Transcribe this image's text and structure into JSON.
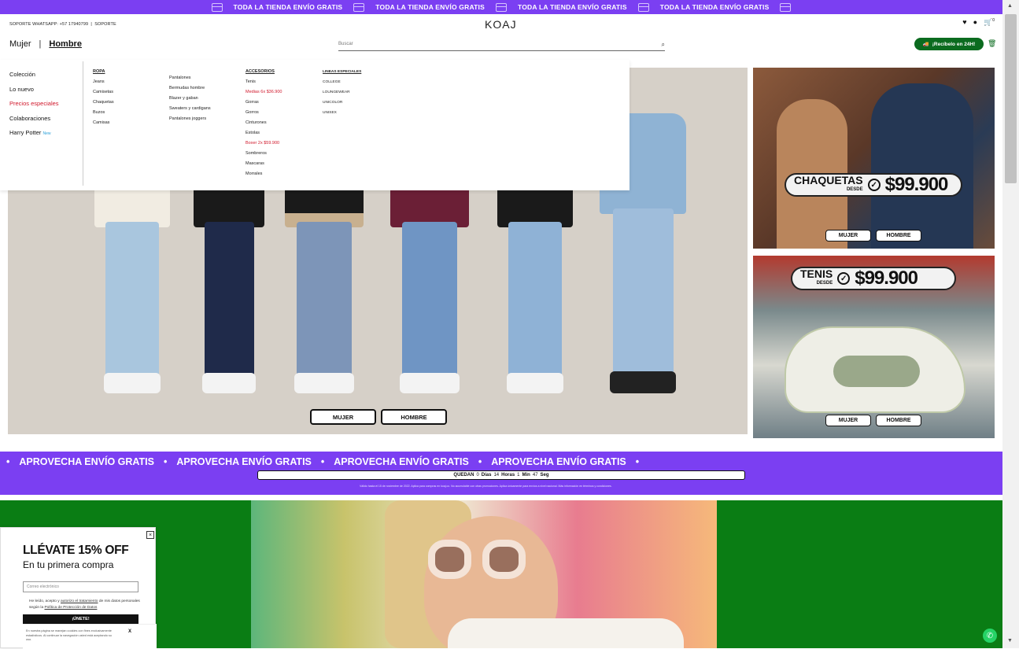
{
  "announcement": {
    "text": "TODA LA TIENDA ENVÍO GRATIS"
  },
  "header": {
    "support_text": "SOPORTE WHATSAPP: +57 17940799",
    "support_link": "SOPORTE",
    "logo": "KOAJ",
    "nav_mujer": "Mujer",
    "nav_sep": "|",
    "nav_hombre": "Hombre",
    "search_placeholder": "Buscar",
    "recibelo": "¡Recíbelo en 24H!",
    "cart_count": "0"
  },
  "dropdown": {
    "left": [
      {
        "label": "Colección"
      },
      {
        "label": "Lo nuevo"
      },
      {
        "label": "Precios especiales"
      },
      {
        "label": "Colaboraciones"
      },
      {
        "label": "Harry Potter",
        "badge": "New"
      }
    ],
    "ropa": {
      "head": "ROPA",
      "col1": [
        "Jeans",
        "Camisetas",
        "Chaquetas",
        "Buzos",
        "Camisas"
      ],
      "col2": [
        "Pantalones",
        "Bermudas hombre",
        "Blazer y gaban",
        "Sweaters y cardigans",
        "Pantalones joggers"
      ]
    },
    "accesorios": {
      "head": "ACCESORIOS",
      "items": [
        "Tenis",
        "Medias 6x $36.900",
        "Gorras",
        "Gorros",
        "Cinturones",
        "Estolas",
        "Boxer 2x $59.900",
        "Sombreros",
        "Mascaras",
        "Morrales"
      ]
    },
    "lineas": {
      "head": "LINEAS ESPECIALES",
      "items": [
        "COLLEGE",
        "LOUNGEWEAR",
        "UNICOLOR",
        "UNISEX"
      ]
    }
  },
  "hero": {
    "btn_mujer": "MUJER",
    "btn_hombre": "HOMBRE"
  },
  "card1": {
    "label": "CHAQUETAS",
    "desde": "DESDE",
    "price": "$99.900",
    "btn_mujer": "MUJER",
    "btn_hombre": "HOMBRE"
  },
  "card2": {
    "label": "TENIS",
    "desde": "DESDE",
    "price": "$99.900",
    "btn_mujer": "MUJER",
    "btn_hombre": "HOMBRE"
  },
  "promo": {
    "marquee": "APROVECHA ENVÍO GRATIS",
    "quedan": "QUEDAN",
    "days_val": "0",
    "days": "Días",
    "hours_val": "14",
    "hours": "Horas",
    "min_val": "1",
    "min": "Min",
    "sec_val": "47",
    "sec": "Seg",
    "fine_print": "Válido hasta el 15 de noviembre de 2022. Aplica para compras en koaj.co. No acumulable con otras promociones. Aplica únicamente para envíos a nivel nacional. Más información en términos y condiciones."
  },
  "popup": {
    "title": "LLÉVATE 15% OFF",
    "subtitle": "En tu primera compra",
    "email_placeholder": "Correo electrónico",
    "legal_1": "He leído, acepto y",
    "legal_link1": "autorizo el tratamiento",
    "legal_2": "de mis datos personales según la",
    "legal_link2": "Política de Protección de Datos",
    "join": "¡ÚNETE!",
    "close": "×"
  },
  "cookie": {
    "text": "En nuestra página se manejan cookies con fines exclusivamente estadísticos. Al continuar la navegación usted está aceptando su uso.",
    "close": "X"
  },
  "colors": {
    "purple": "#7b3ff2",
    "green": "#0a7d14",
    "red": "#d0182b"
  }
}
